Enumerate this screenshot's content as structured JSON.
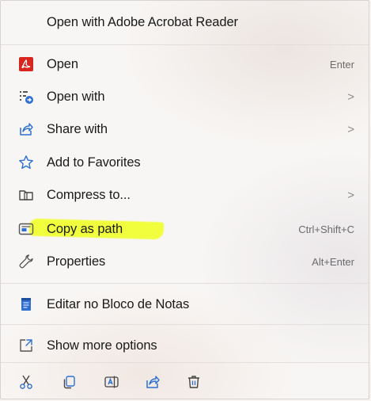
{
  "menu": {
    "header_label": "Open with Adobe Acrobat Reader",
    "items": [
      {
        "label": "Open",
        "shortcut": "Enter",
        "icon": "acrobat-icon"
      },
      {
        "label": "Open with",
        "chevron": ">",
        "icon": "open-with-icon"
      },
      {
        "label": "Share with",
        "chevron": ">",
        "icon": "share-icon"
      },
      {
        "label": "Add to Favorites",
        "icon": "star-icon"
      },
      {
        "label": "Compress to...",
        "chevron": ">",
        "icon": "compress-folder-icon"
      },
      {
        "label": "Copy as path",
        "shortcut": "Ctrl+Shift+C",
        "icon": "copy-path-icon"
      },
      {
        "label": "Properties",
        "shortcut": "Alt+Enter",
        "icon": "wrench-icon"
      },
      {
        "label": "Editar no Bloco de Notas",
        "icon": "notepad-icon"
      },
      {
        "label": "Show more options",
        "icon": "show-more-icon"
      }
    ],
    "bottom_actions": [
      {
        "icon": "cut-icon"
      },
      {
        "icon": "copy-icon"
      },
      {
        "icon": "rename-icon"
      },
      {
        "icon": "share-icon"
      },
      {
        "icon": "delete-icon"
      }
    ],
    "colors": {
      "accent_blue": "#2f6fd1",
      "acrobat_red": "#d7261e",
      "highlight_yellow": "#f0ff1e"
    }
  }
}
